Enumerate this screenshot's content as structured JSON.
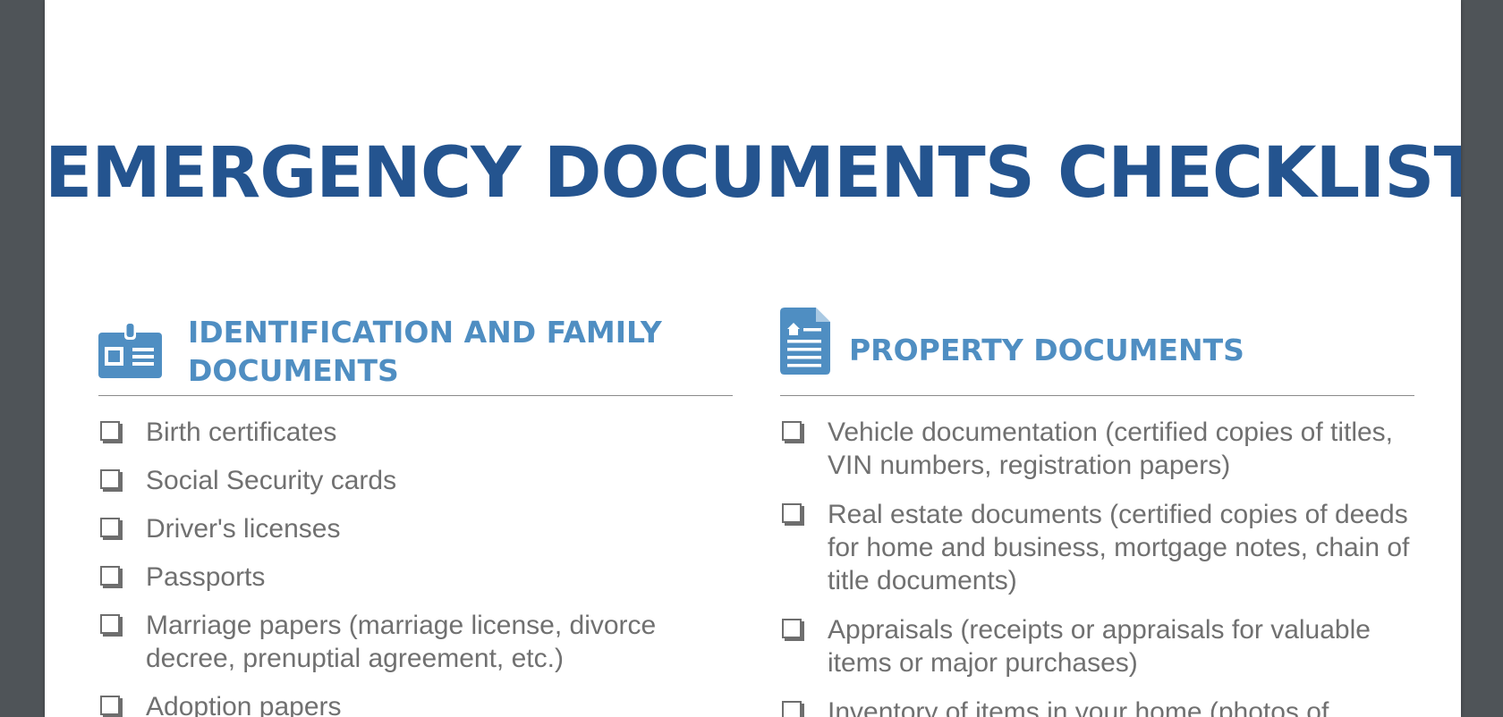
{
  "document": {
    "title": "EMERGENCY DOCUMENTS CHECKLIST",
    "colors": {
      "title": "#24548f",
      "section_title": "#4f8ec2",
      "body_text": "#707070",
      "viewer_background": "#4f5458",
      "page_background": "#ffffff"
    },
    "sections": [
      {
        "icon": "id-badge-icon",
        "title": "IDENTIFICATION AND FAMILY DOCUMENTS",
        "items": [
          "Birth certificates",
          "Social Security cards",
          "Driver's licenses",
          "Passports",
          "Marriage papers (marriage license, divorce decree, prenuptial agreement, etc.)",
          "Adoption papers"
        ]
      },
      {
        "icon": "property-document-icon",
        "title": "PROPERTY DOCUMENTS",
        "items": [
          "Vehicle documentation (certified copies of titles, VIN numbers, registration papers)",
          "Real estate documents (certified copies of deeds for home and business, mortgage notes, chain of title documents)",
          "Appraisals (receipts or appraisals for valuable items or major purchases)",
          "Inventory of items in your home (photos of"
        ]
      }
    ]
  }
}
